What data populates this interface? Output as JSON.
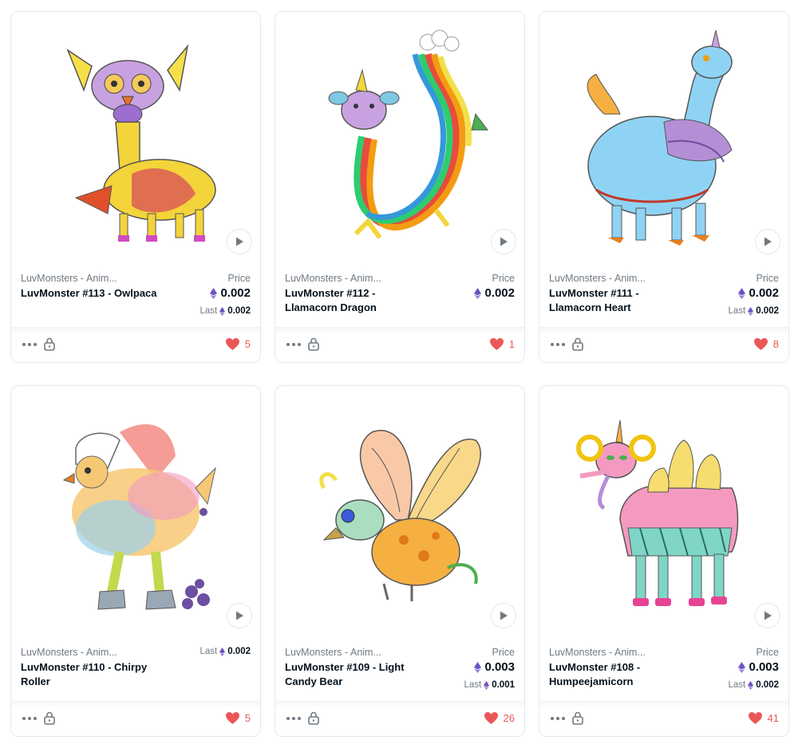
{
  "accent_like": "#eb5757",
  "eth_color": "#6c52c4",
  "cards": [
    {
      "collection": "LuvMonsters - Anim...",
      "name": "LuvMonster #113 - Owlpaca",
      "price_label": "Price",
      "price": "0.002",
      "last_label": "Last",
      "last": "0.002",
      "likes": "5",
      "play_icon": "play-icon"
    },
    {
      "collection": "LuvMonsters - Anim...",
      "name": "LuvMonster #112 - Llamacorn Dragon",
      "price_label": "Price",
      "price": "0.002",
      "likes": "1",
      "play_icon": "play-icon"
    },
    {
      "collection": "LuvMonsters - Anim...",
      "name": "LuvMonster #111 - Llamacorn Heart",
      "price_label": "Price",
      "price": "0.002",
      "last_label": "Last",
      "last": "0.002",
      "likes": "8",
      "play_icon": "play-icon"
    },
    {
      "collection": "LuvMonsters - Anim...",
      "name": "LuvMonster #110 - Chirpy Roller",
      "last_label": "Last",
      "last": "0.002",
      "likes": "5",
      "play_icon": "play-icon"
    },
    {
      "collection": "LuvMonsters - Anim...",
      "name": "LuvMonster #109 - Light Candy Bear",
      "price_label": "Price",
      "price": "0.003",
      "last_label": "Last",
      "last": "0.001",
      "likes": "26",
      "play_icon": "play-icon"
    },
    {
      "collection": "LuvMonsters - Anim...",
      "name": "LuvMonster #108 - Humpeejamicorn",
      "price_label": "Price",
      "price": "0.003",
      "last_label": "Last",
      "last": "0.002",
      "likes": "41",
      "play_icon": "play-icon"
    }
  ]
}
